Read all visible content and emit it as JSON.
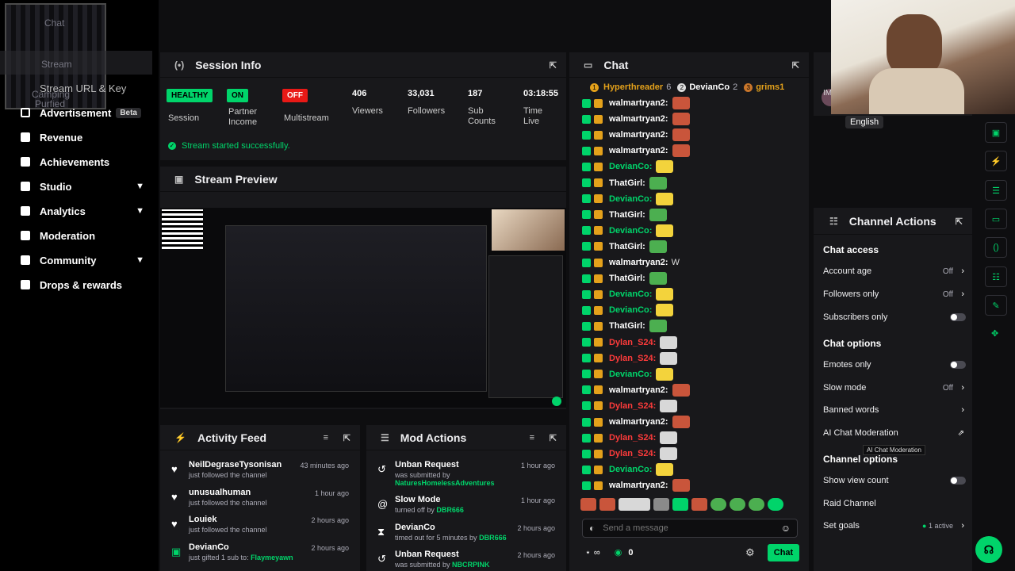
{
  "sidebar": {
    "overlay_lines": [
      "Chat",
      "Stream",
      "Camping",
      "Purfied"
    ],
    "stream_url_label": "Stream URL & Key",
    "items": [
      {
        "label": "Advertisement",
        "badge": "Beta",
        "icon": "ad-icon"
      },
      {
        "label": "Revenue",
        "icon": "revenue-icon"
      },
      {
        "label": "Achievements",
        "icon": "trophy-icon"
      },
      {
        "label": "Studio",
        "icon": "studio-icon",
        "expandable": true
      },
      {
        "label": "Analytics",
        "icon": "analytics-icon",
        "expandable": true
      },
      {
        "label": "Moderation",
        "icon": "wrench-icon"
      },
      {
        "label": "Community",
        "icon": "community-icon",
        "expandable": true
      },
      {
        "label": "Drops & rewards",
        "icon": "drops-icon"
      }
    ]
  },
  "session": {
    "title": "Session Info",
    "stats": [
      {
        "badge": "HEALTHY",
        "badge_color": "#00d46a",
        "label": "Session"
      },
      {
        "badge": "ON",
        "badge_color": "#00d46a",
        "label": "Partner Income"
      },
      {
        "badge": "OFF",
        "badge_color": "#e91916",
        "label": "Multistream"
      },
      {
        "value": "406",
        "label": "Viewers"
      },
      {
        "value": "33,031",
        "label": "Followers"
      },
      {
        "value": "187",
        "label": "Sub Counts"
      },
      {
        "value": "03:18:55",
        "label": "Time Live"
      }
    ],
    "status_message": "Stream started successfully."
  },
  "preview": {
    "title": "Stream Preview"
  },
  "activity": {
    "title": "Activity Feed",
    "rows": [
      {
        "name": "NeilDegraseTysonisan",
        "sub": "just followed the channel",
        "time": "43 minutes ago",
        "icon": "heart-icon"
      },
      {
        "name": "unusualhuman",
        "sub": "just followed the channel",
        "time": "1 hour ago",
        "icon": "heart-icon"
      },
      {
        "name": "Louiek",
        "sub": "just followed the channel",
        "time": "2 hours ago",
        "icon": "heart-icon"
      },
      {
        "name": "DevianCo",
        "sub_prefix": "just gifted 1 sub to:",
        "sub_target": "Flaymeyawn",
        "time": "2 hours ago",
        "icon": "gift-icon"
      }
    ]
  },
  "mod": {
    "title": "Mod Actions",
    "rows": [
      {
        "name": "Unban Request",
        "sub_prefix": "was submitted by",
        "sub_target": "NaturesHomelessAdventures",
        "time": "1 hour ago",
        "icon": "undo-icon"
      },
      {
        "name": "Slow Mode",
        "sub_prefix": "turned off by",
        "sub_target": "DBR666",
        "time": "1 hour ago",
        "icon": "snail-icon"
      },
      {
        "name": "DevianCo",
        "sub_prefix": "timed out for 5 minutes by",
        "sub_target": "DBR666",
        "time": "2 hours ago",
        "icon": "hourglass-icon"
      },
      {
        "name": "Unban Request",
        "sub_prefix": "was submitted by",
        "sub_target": "NBCRPINK",
        "time": "2 hours ago",
        "icon": "undo-icon"
      }
    ]
  },
  "chat": {
    "title": "Chat",
    "leaderboard": [
      {
        "rank": "1",
        "name": "Hyperthreader",
        "count": "6"
      },
      {
        "rank": "2",
        "name": "DevianCo",
        "count": "2"
      },
      {
        "rank": "3",
        "name": "grims1",
        "count": ""
      }
    ],
    "messages": [
      {
        "user": "walmartryan2:",
        "color": "#fff",
        "emote": "#c9553b"
      },
      {
        "user": "walmartryan2:",
        "color": "#fff",
        "emote": "#c9553b"
      },
      {
        "user": "walmartryan2:",
        "color": "#fff",
        "emote": "#c9553b"
      },
      {
        "user": "walmartryan2:",
        "color": "#fff",
        "emote": "#c9553b"
      },
      {
        "user": "DevianCo:",
        "color": "#00d46a",
        "emote": "#f3d33c"
      },
      {
        "user": "ThatGirl:",
        "color": "#fff",
        "emote": "#4caf50"
      },
      {
        "user": "DevianCo:",
        "color": "#00d46a",
        "emote": "#f3d33c"
      },
      {
        "user": "ThatGirl:",
        "color": "#fff",
        "emote": "#4caf50"
      },
      {
        "user": "DevianCo:",
        "color": "#00d46a",
        "emote": "#f3d33c"
      },
      {
        "user": "ThatGirl:",
        "color": "#fff",
        "emote": "#4caf50"
      },
      {
        "user": "walmartryan2:",
        "color": "#fff",
        "text": "W"
      },
      {
        "user": "ThatGirl:",
        "color": "#fff",
        "emote": "#4caf50"
      },
      {
        "user": "DevianCo:",
        "color": "#00d46a",
        "emote": "#f3d33c"
      },
      {
        "user": "DevianCo:",
        "color": "#00d46a",
        "emote": "#f3d33c"
      },
      {
        "user": "ThatGirl:",
        "color": "#fff",
        "emote": "#4caf50"
      },
      {
        "user": "Dylan_S24:",
        "color": "#ff3b3b",
        "emote": "#d8d8d8"
      },
      {
        "user": "Dylan_S24:",
        "color": "#ff3b3b",
        "emote": "#d8d8d8"
      },
      {
        "user": "DevianCo:",
        "color": "#00d46a",
        "emote": "#f3d33c"
      },
      {
        "user": "walmartryan2:",
        "color": "#fff",
        "emote": "#c9553b"
      },
      {
        "user": "Dylan_S24:",
        "color": "#ff3b3b",
        "emote": "#d8d8d8"
      },
      {
        "user": "walmartryan2:",
        "color": "#fff",
        "emote": "#c9553b"
      },
      {
        "user": "Dylan_S24:",
        "color": "#ff3b3b",
        "emote": "#d8d8d8"
      },
      {
        "user": "Dylan_S24:",
        "color": "#ff3b3b",
        "emote": "#d8d8d8"
      },
      {
        "user": "DevianCo:",
        "color": "#00d46a",
        "emote": "#f3d33c"
      },
      {
        "user": "walmartryan2:",
        "color": "#fff",
        "emote": "#c9553b"
      }
    ],
    "input_placeholder": "Send a message",
    "points": "0",
    "send_label": "Chat"
  },
  "channel_actions": {
    "title": "Channel Actions",
    "language": "English",
    "sections": [
      {
        "title": "Chat access",
        "rows": [
          {
            "label": "Account age",
            "value": "Off",
            "kind": "arrow"
          },
          {
            "label": "Followers only",
            "value": "Off",
            "kind": "arrow"
          },
          {
            "label": "Subscribers only",
            "kind": "toggle"
          }
        ]
      },
      {
        "title": "Chat options",
        "rows": [
          {
            "label": "Emotes only",
            "kind": "toggle"
          },
          {
            "label": "Slow mode",
            "value": "Off",
            "kind": "arrow"
          },
          {
            "label": "Banned words",
            "kind": "arrow"
          },
          {
            "label": "AI Chat Moderation",
            "kind": "external"
          }
        ]
      },
      {
        "title": "Channel options",
        "rows": [
          {
            "label": "Show view count",
            "kind": "toggle"
          },
          {
            "label": "Raid Channel",
            "kind": "none"
          },
          {
            "label": "Set goals",
            "value": "1 active",
            "kind": "arrow"
          }
        ]
      }
    ],
    "tooltip": "AI Chat Moderation"
  },
  "colors": {
    "accent": "#00d46a",
    "danger": "#e91916",
    "panel": "#18181b"
  }
}
